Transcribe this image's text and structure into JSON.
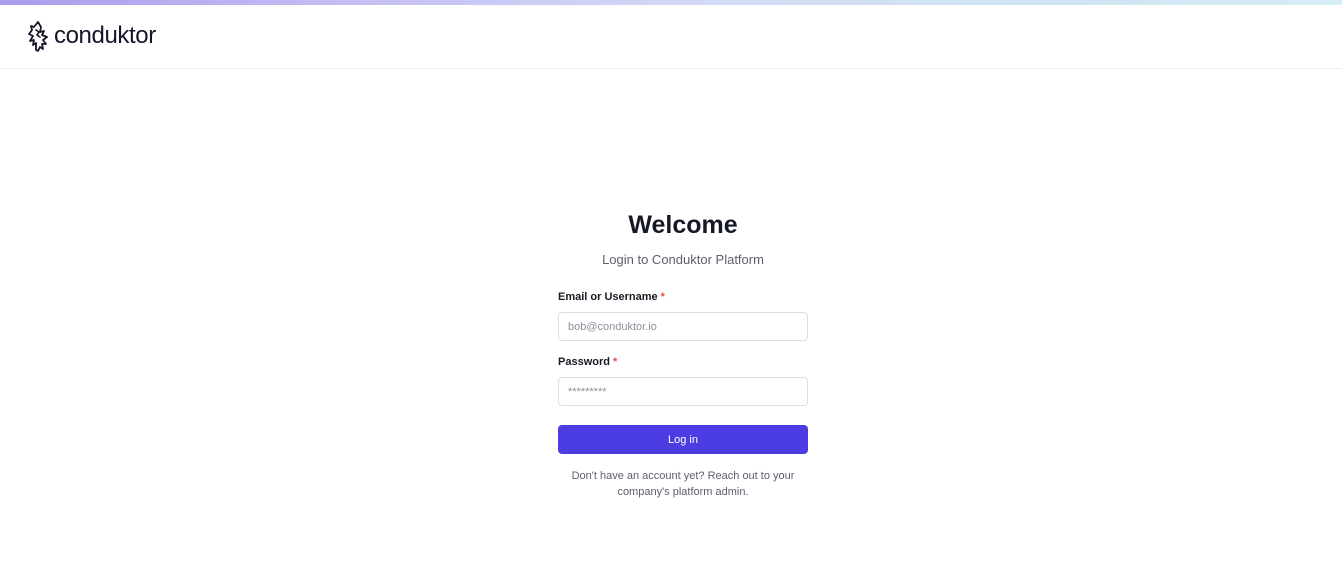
{
  "brand": {
    "name": "conduktor",
    "logo_icon": "conduktor-logo-icon",
    "accent_color": "#4c3de3",
    "required_color": "#e5484d"
  },
  "login": {
    "title": "Welcome",
    "subtitle": "Login to Conduktor Platform",
    "email_label": "Email or Username",
    "email_placeholder": "bob@conduktor.io",
    "password_label": "Password",
    "password_placeholder": "*********",
    "required_mark": "*",
    "submit_label": "Log in",
    "footer_note": "Don't have an account yet? Reach out to your company's platform admin."
  }
}
